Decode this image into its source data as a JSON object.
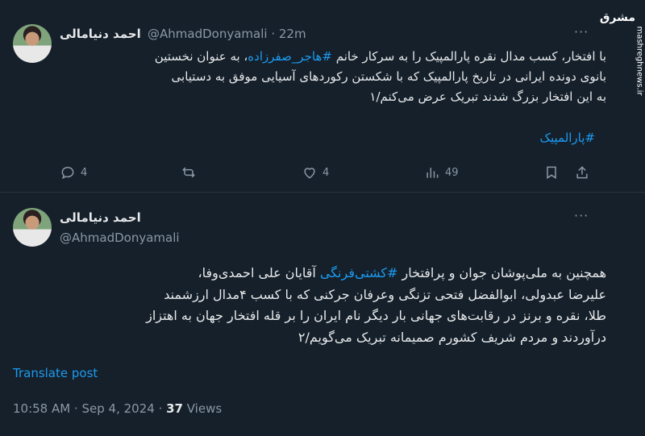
{
  "tweet1": {
    "name": "احمد دنیامالی",
    "handle": "@AhmadDonyamali",
    "time": "· 22m",
    "more": "···",
    "line1_prefix": "با افتخار، کسب مدال نقره پارالمپیک را به سرکار خانم ",
    "line1_hashtag": "#هاجر_صفرزاده",
    "line1_suffix": "، به عنوان نخستین",
    "line2": "بانوی دونده ایرانی در تاریخ پارالمپیک که با شکستن رکوردهای آسیایی موفق به دستیابی",
    "line3": "به این افتخار بزرگ شدند تبریک عرض می‌کنم/۱",
    "hashtag_line": "#پارالمپیک",
    "replies": "4",
    "retweets": "",
    "likes": "4",
    "views": "49"
  },
  "tweet2": {
    "name": "احمد دنیامالی",
    "handle": "@AhmadDonyamali",
    "more": "···",
    "line1_prefix": "همچنین به ملی‌پوشان جوان و پرافتخار ",
    "line1_hashtag": "#کشتی‌فرنگی",
    "line1_suffix": " آقایان علی احمدی‌وفا،",
    "line2": "علیرضا عبدولی، ابوالفضل فتحی تزنگی وعرفان جرکنی که با کسب ۴مدال ارزشمند",
    "line3": "طلا، نقره و برنز در رقابت‌های جهانی بار دیگر نام ایران را بر قله افتخار جهان به اهتزاز",
    "line4": "درآوردند و مردم شریف کشورم صمیمانه تبریک می‌گویم/۲",
    "translate": "Translate post",
    "time": "10:58 AM · Sep 4, 2024 · ",
    "views_count": "37",
    "views_label": " Views"
  },
  "watermark": {
    "logo": "مشرق",
    "site": "mashreghnews.ir"
  },
  "colors": {
    "background": "#15202b",
    "link": "#1d9bf0",
    "muted": "#8b98a5"
  }
}
